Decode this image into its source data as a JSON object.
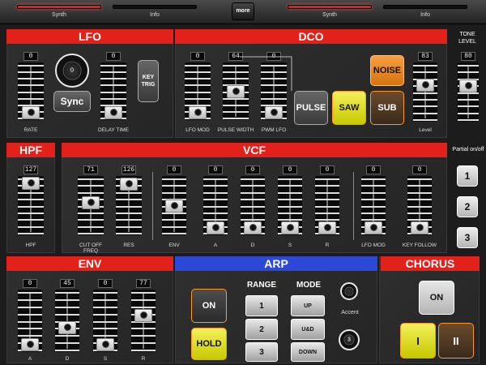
{
  "tabs": [
    {
      "label": "Synth",
      "active": true
    },
    {
      "label": "Info",
      "active": false
    },
    {
      "label": "Synth",
      "active": true
    },
    {
      "label": "Info",
      "active": false
    }
  ],
  "more_label": "more",
  "lfo": {
    "title": "LFO",
    "rate": {
      "label": "RATE",
      "value": "0",
      "level": 0.0
    },
    "delay": {
      "label": "DELAY TIME",
      "value": "0",
      "level": 0.0
    },
    "knob_value": "0",
    "sync_label": "Sync",
    "keytrig_label": "KEY TRIG"
  },
  "dco": {
    "title": "DCO",
    "lfo_mod": {
      "label": "LFO MOD",
      "value": "0",
      "level": 0.0
    },
    "pulse_width": {
      "label": "PULSE WIDTH",
      "value": "64",
      "level": 0.5
    },
    "pwm_lfo": {
      "label": "PWM LFO",
      "value": "0",
      "level": 0.0
    },
    "level": {
      "label": "Level",
      "value": "83",
      "level": 0.65
    },
    "pulse_label": "PULSE",
    "saw_label": "SAW",
    "noise_label": "NOISE",
    "sub_label": "SUB"
  },
  "tone_level": {
    "title": "TONE LEVEL",
    "value": "80",
    "level": 0.63
  },
  "partial": {
    "title": "Partial on/off",
    "buttons": [
      "1",
      "2",
      "3"
    ]
  },
  "hpf": {
    "title": "HPF",
    "slider": {
      "label": "HPF",
      "value": "127",
      "level": 1.0
    }
  },
  "vcf": {
    "title": "VCF",
    "sliders": [
      {
        "label": "CUT OFF FREQ",
        "value": "71",
        "level": 0.56
      },
      {
        "label": "RES",
        "value": "126",
        "level": 0.99
      },
      {
        "label": "ENV",
        "value": "0",
        "level": 0.5
      },
      {
        "label": "A",
        "value": "0",
        "level": 0.0
      },
      {
        "label": "D",
        "value": "0",
        "level": 0.0
      },
      {
        "label": "S",
        "value": "0",
        "level": 0.0
      },
      {
        "label": "R",
        "value": "0",
        "level": 0.0
      },
      {
        "label": "LFO MOD",
        "value": "0",
        "level": 0.0
      },
      {
        "label": "KEY FOLLOW",
        "value": "0",
        "level": 0.0
      }
    ]
  },
  "env": {
    "title": "ENV",
    "sliders": [
      {
        "label": "A",
        "value": "0",
        "level": 0.0
      },
      {
        "label": "D",
        "value": "45",
        "level": 0.35
      },
      {
        "label": "S",
        "value": "0",
        "level": 0.0
      },
      {
        "label": "R",
        "value": "77",
        "level": 0.61
      }
    ]
  },
  "arp": {
    "title": "ARP",
    "on_label": "ON",
    "hold_label": "HOLD",
    "range_title": "RANGE",
    "range_buttons": [
      "1",
      "2",
      "3"
    ],
    "mode_title": "MODE",
    "mode_buttons": [
      "UP",
      "U&D",
      "DOWN"
    ],
    "accent_label": "Accent",
    "knob2_value": "3"
  },
  "chorus": {
    "title": "CHORUS",
    "on_label": "ON",
    "i_label": "I",
    "ii_label": "II"
  },
  "colors": {
    "accent_red": "#e3211b",
    "arp_blue": "#2b49d6",
    "saw_yellow": "#f2f25a",
    "noise_orange": "#f6a042"
  }
}
